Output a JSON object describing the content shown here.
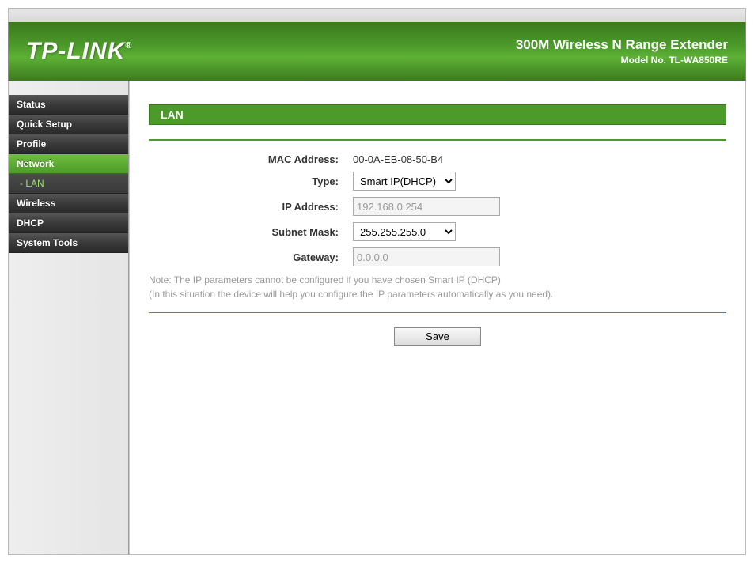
{
  "header": {
    "brand": "TP-LINK",
    "brand_reg": "®",
    "product": "300M Wireless N Range Extender",
    "model": "Model No. TL-WA850RE"
  },
  "sidebar": {
    "items": [
      {
        "label": "Status",
        "selected": false
      },
      {
        "label": "Quick Setup",
        "selected": false
      },
      {
        "label": "Profile",
        "selected": false
      },
      {
        "label": "Network",
        "selected": true
      },
      {
        "label": "Wireless",
        "selected": false
      },
      {
        "label": "DHCP",
        "selected": false
      },
      {
        "label": "System Tools",
        "selected": false
      }
    ],
    "sub": {
      "label": "- LAN",
      "active": true
    }
  },
  "main": {
    "section_title": "LAN",
    "fields": {
      "mac_label": "MAC Address:",
      "mac_value": "00-0A-EB-08-50-B4",
      "type_label": "Type:",
      "type_value": "Smart IP(DHCP)",
      "ip_label": "IP Address:",
      "ip_value": "192.168.0.254",
      "mask_label": "Subnet Mask:",
      "mask_value": "255.255.255.0",
      "gateway_label": "Gateway:",
      "gateway_value": "0.0.0.0"
    },
    "note_line1": "Note: The IP parameters cannot be configured if you have chosen Smart IP (DHCP)",
    "note_line2": "(In this situation the device will help you configure the IP parameters automatically as you need).",
    "save_label": "Save"
  }
}
